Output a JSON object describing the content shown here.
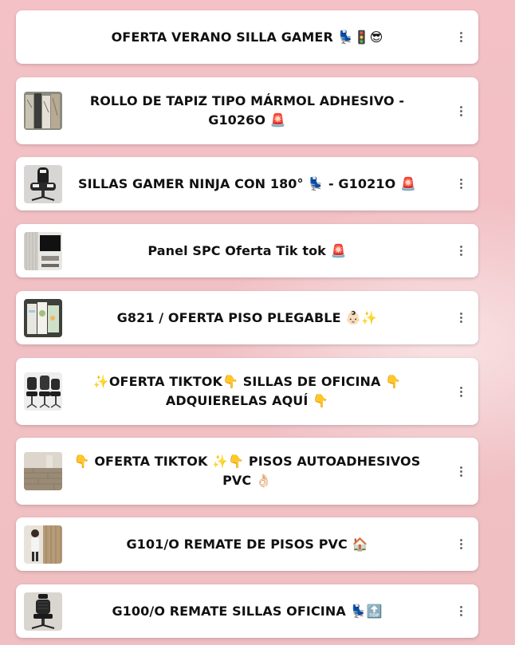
{
  "links": [
    {
      "title": "OFERTA VERANO SILLA GAMER 💺🚦😎",
      "thumb_icon": "none"
    },
    {
      "title": "ROLLO DE TAPIZ TIPO MÁRMOL ADHESIVO - G1026O 🚨",
      "thumb_icon": "marble-rolls-thumbnail"
    },
    {
      "title": "SILLAS GAMER NINJA CON 180° 💺 - G1021O 🚨",
      "thumb_icon": "gamer-chair-thumbnail"
    },
    {
      "title": "Panel SPC Oferta Tik tok 🚨",
      "thumb_icon": "wall-panel-thumbnail"
    },
    {
      "title": "G821 / OFERTA PISO PLEGABLE 👶🏻✨",
      "thumb_icon": "folding-mat-thumbnail"
    },
    {
      "title": "✨OFERTA TIKTOK👇 SILLAS DE OFICINA 👇 ADQUIERELAS AQUÍ 👇",
      "thumb_icon": "office-chairs-thumbnail"
    },
    {
      "title": "👇 OFERTA TIKTOK ✨👇 PISOS AUTOADHESIVOS PVC 👌🏻",
      "thumb_icon": "wood-floor-thumbnail"
    },
    {
      "title": "G101/O REMATE DE PISOS PVC 🏠",
      "thumb_icon": "person-floor-thumbnail"
    },
    {
      "title": "G100/O REMATE SILLAS OFICINA 💺🔝",
      "thumb_icon": "ergonomic-chair-thumbnail"
    }
  ],
  "more_icon": "more-vertical-icon"
}
